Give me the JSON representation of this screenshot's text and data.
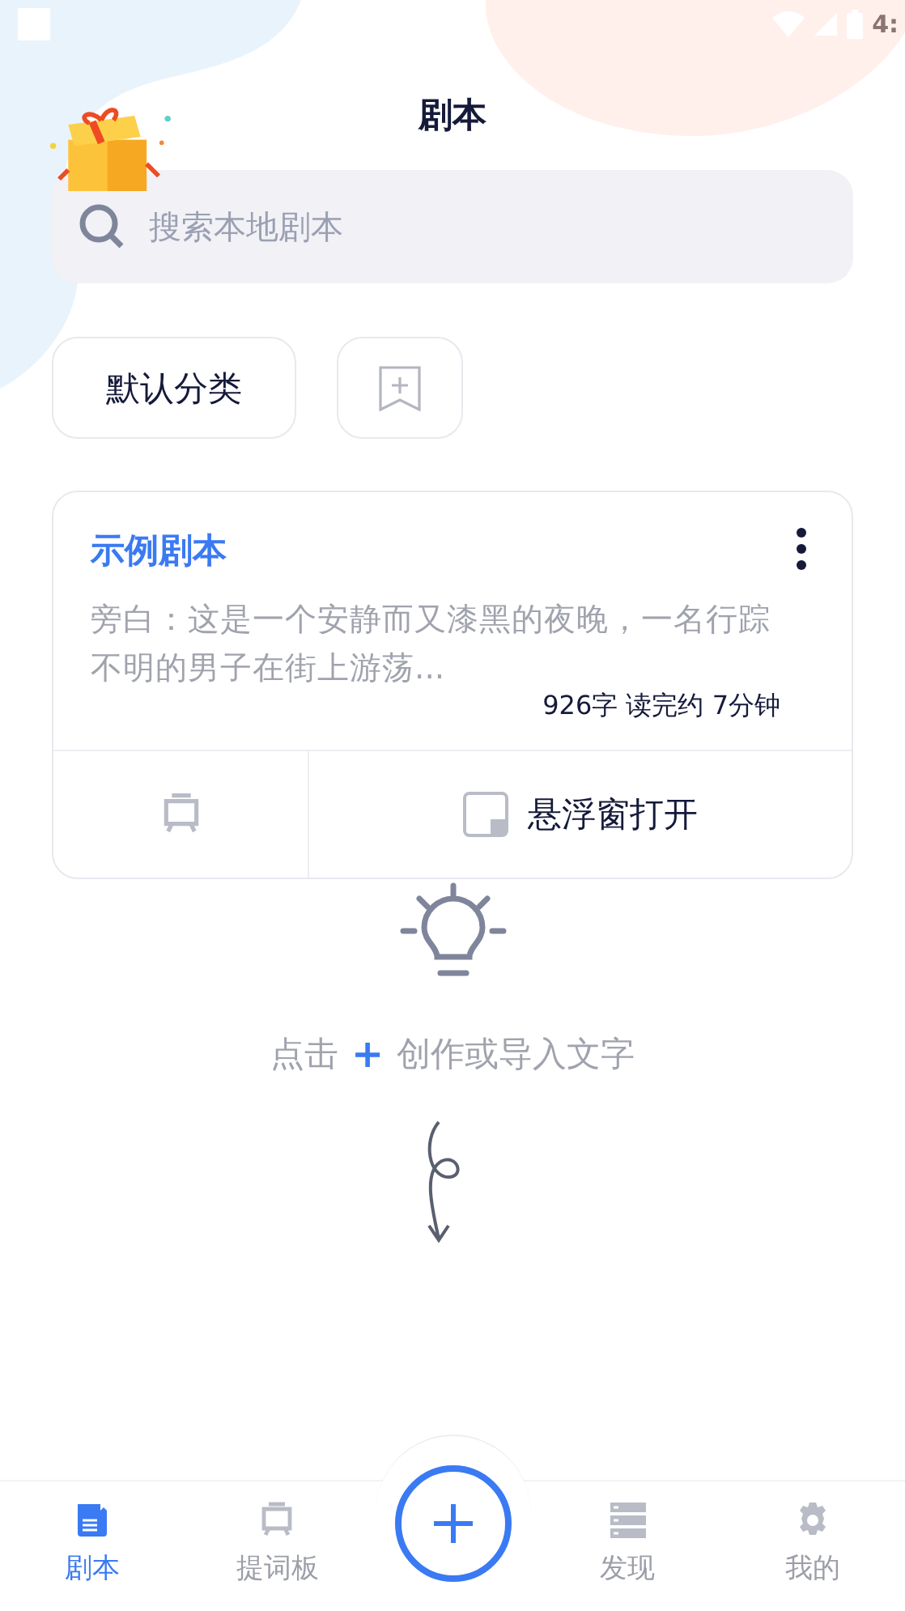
{
  "status_bar": {
    "time": "4:"
  },
  "header": {
    "title": "剧本"
  },
  "search": {
    "placeholder": "搜索本地剧本"
  },
  "category": {
    "label": "默认分类"
  },
  "scripts": [
    {
      "title": "示例剧本",
      "excerpt": "旁白：这是一个安静而又漆黑的夜晚，一名行踪不明的男子在街上游荡...",
      "stats": "926字 读完约 7分钟",
      "float_label": "悬浮窗打开"
    }
  ],
  "empty_hint": {
    "before": "点击",
    "plus": "+",
    "after": "创作或导入文字"
  },
  "bottom_nav": [
    {
      "label": "剧本",
      "kind": "script",
      "selected": true
    },
    {
      "label": "提词板",
      "kind": "prompter",
      "selected": false
    },
    {
      "kind": "add"
    },
    {
      "label": "发现",
      "kind": "discover",
      "selected": false
    },
    {
      "label": "我的",
      "kind": "settings",
      "selected": false
    }
  ]
}
